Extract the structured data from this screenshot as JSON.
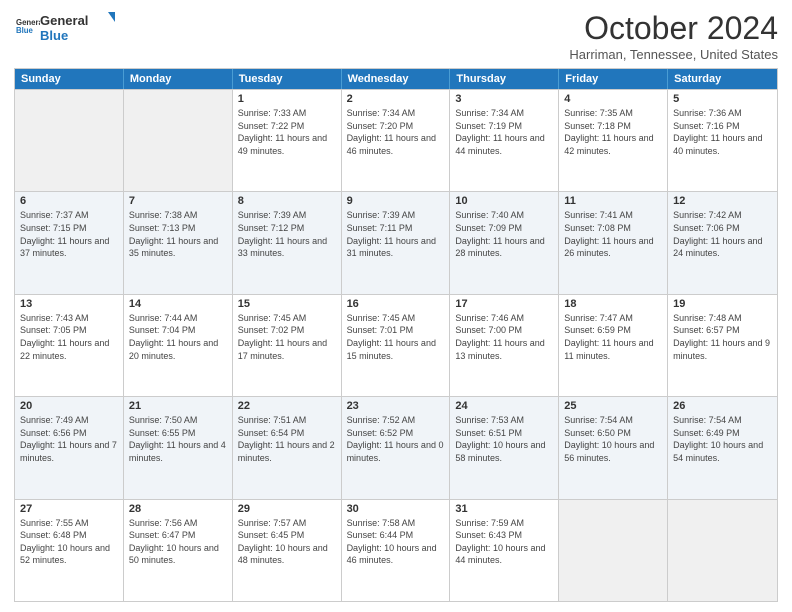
{
  "header": {
    "logo": {
      "line1": "General",
      "line2": "Blue"
    },
    "title": "October 2024",
    "location": "Harriman, Tennessee, United States"
  },
  "days_of_week": [
    "Sunday",
    "Monday",
    "Tuesday",
    "Wednesday",
    "Thursday",
    "Friday",
    "Saturday"
  ],
  "weeks": [
    [
      {
        "day": "",
        "sunrise": "",
        "sunset": "",
        "daylight": ""
      },
      {
        "day": "",
        "sunrise": "",
        "sunset": "",
        "daylight": ""
      },
      {
        "day": "1",
        "sunrise": "Sunrise: 7:33 AM",
        "sunset": "Sunset: 7:22 PM",
        "daylight": "Daylight: 11 hours and 49 minutes."
      },
      {
        "day": "2",
        "sunrise": "Sunrise: 7:34 AM",
        "sunset": "Sunset: 7:20 PM",
        "daylight": "Daylight: 11 hours and 46 minutes."
      },
      {
        "day": "3",
        "sunrise": "Sunrise: 7:34 AM",
        "sunset": "Sunset: 7:19 PM",
        "daylight": "Daylight: 11 hours and 44 minutes."
      },
      {
        "day": "4",
        "sunrise": "Sunrise: 7:35 AM",
        "sunset": "Sunset: 7:18 PM",
        "daylight": "Daylight: 11 hours and 42 minutes."
      },
      {
        "day": "5",
        "sunrise": "Sunrise: 7:36 AM",
        "sunset": "Sunset: 7:16 PM",
        "daylight": "Daylight: 11 hours and 40 minutes."
      }
    ],
    [
      {
        "day": "6",
        "sunrise": "Sunrise: 7:37 AM",
        "sunset": "Sunset: 7:15 PM",
        "daylight": "Daylight: 11 hours and 37 minutes."
      },
      {
        "day": "7",
        "sunrise": "Sunrise: 7:38 AM",
        "sunset": "Sunset: 7:13 PM",
        "daylight": "Daylight: 11 hours and 35 minutes."
      },
      {
        "day": "8",
        "sunrise": "Sunrise: 7:39 AM",
        "sunset": "Sunset: 7:12 PM",
        "daylight": "Daylight: 11 hours and 33 minutes."
      },
      {
        "day": "9",
        "sunrise": "Sunrise: 7:39 AM",
        "sunset": "Sunset: 7:11 PM",
        "daylight": "Daylight: 11 hours and 31 minutes."
      },
      {
        "day": "10",
        "sunrise": "Sunrise: 7:40 AM",
        "sunset": "Sunset: 7:09 PM",
        "daylight": "Daylight: 11 hours and 28 minutes."
      },
      {
        "day": "11",
        "sunrise": "Sunrise: 7:41 AM",
        "sunset": "Sunset: 7:08 PM",
        "daylight": "Daylight: 11 hours and 26 minutes."
      },
      {
        "day": "12",
        "sunrise": "Sunrise: 7:42 AM",
        "sunset": "Sunset: 7:06 PM",
        "daylight": "Daylight: 11 hours and 24 minutes."
      }
    ],
    [
      {
        "day": "13",
        "sunrise": "Sunrise: 7:43 AM",
        "sunset": "Sunset: 7:05 PM",
        "daylight": "Daylight: 11 hours and 22 minutes."
      },
      {
        "day": "14",
        "sunrise": "Sunrise: 7:44 AM",
        "sunset": "Sunset: 7:04 PM",
        "daylight": "Daylight: 11 hours and 20 minutes."
      },
      {
        "day": "15",
        "sunrise": "Sunrise: 7:45 AM",
        "sunset": "Sunset: 7:02 PM",
        "daylight": "Daylight: 11 hours and 17 minutes."
      },
      {
        "day": "16",
        "sunrise": "Sunrise: 7:45 AM",
        "sunset": "Sunset: 7:01 PM",
        "daylight": "Daylight: 11 hours and 15 minutes."
      },
      {
        "day": "17",
        "sunrise": "Sunrise: 7:46 AM",
        "sunset": "Sunset: 7:00 PM",
        "daylight": "Daylight: 11 hours and 13 minutes."
      },
      {
        "day": "18",
        "sunrise": "Sunrise: 7:47 AM",
        "sunset": "Sunset: 6:59 PM",
        "daylight": "Daylight: 11 hours and 11 minutes."
      },
      {
        "day": "19",
        "sunrise": "Sunrise: 7:48 AM",
        "sunset": "Sunset: 6:57 PM",
        "daylight": "Daylight: 11 hours and 9 minutes."
      }
    ],
    [
      {
        "day": "20",
        "sunrise": "Sunrise: 7:49 AM",
        "sunset": "Sunset: 6:56 PM",
        "daylight": "Daylight: 11 hours and 7 minutes."
      },
      {
        "day": "21",
        "sunrise": "Sunrise: 7:50 AM",
        "sunset": "Sunset: 6:55 PM",
        "daylight": "Daylight: 11 hours and 4 minutes."
      },
      {
        "day": "22",
        "sunrise": "Sunrise: 7:51 AM",
        "sunset": "Sunset: 6:54 PM",
        "daylight": "Daylight: 11 hours and 2 minutes."
      },
      {
        "day": "23",
        "sunrise": "Sunrise: 7:52 AM",
        "sunset": "Sunset: 6:52 PM",
        "daylight": "Daylight: 11 hours and 0 minutes."
      },
      {
        "day": "24",
        "sunrise": "Sunrise: 7:53 AM",
        "sunset": "Sunset: 6:51 PM",
        "daylight": "Daylight: 10 hours and 58 minutes."
      },
      {
        "day": "25",
        "sunrise": "Sunrise: 7:54 AM",
        "sunset": "Sunset: 6:50 PM",
        "daylight": "Daylight: 10 hours and 56 minutes."
      },
      {
        "day": "26",
        "sunrise": "Sunrise: 7:54 AM",
        "sunset": "Sunset: 6:49 PM",
        "daylight": "Daylight: 10 hours and 54 minutes."
      }
    ],
    [
      {
        "day": "27",
        "sunrise": "Sunrise: 7:55 AM",
        "sunset": "Sunset: 6:48 PM",
        "daylight": "Daylight: 10 hours and 52 minutes."
      },
      {
        "day": "28",
        "sunrise": "Sunrise: 7:56 AM",
        "sunset": "Sunset: 6:47 PM",
        "daylight": "Daylight: 10 hours and 50 minutes."
      },
      {
        "day": "29",
        "sunrise": "Sunrise: 7:57 AM",
        "sunset": "Sunset: 6:45 PM",
        "daylight": "Daylight: 10 hours and 48 minutes."
      },
      {
        "day": "30",
        "sunrise": "Sunrise: 7:58 AM",
        "sunset": "Sunset: 6:44 PM",
        "daylight": "Daylight: 10 hours and 46 minutes."
      },
      {
        "day": "31",
        "sunrise": "Sunrise: 7:59 AM",
        "sunset": "Sunset: 6:43 PM",
        "daylight": "Daylight: 10 hours and 44 minutes."
      },
      {
        "day": "",
        "sunrise": "",
        "sunset": "",
        "daylight": ""
      },
      {
        "day": "",
        "sunrise": "",
        "sunset": "",
        "daylight": ""
      }
    ]
  ]
}
